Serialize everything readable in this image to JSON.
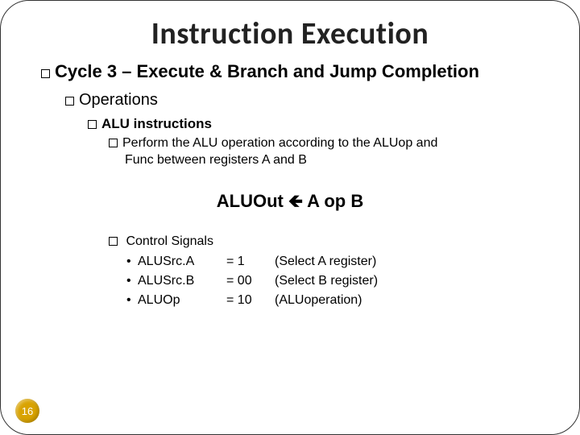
{
  "title": "Instruction Execution",
  "l1_prefix_bold": "Cycle 3",
  "l1_rest": " – Execute & Branch and Jump Completion",
  "l2": "Operations",
  "l3": "ALU instructions",
  "l4_a": "Perform the ALU operation according to the ALUop and",
  "l4_b": "Func between registers A and B",
  "expr_lhs": "ALUOut ",
  "expr_rhs": " A op B",
  "signals_head": " Control Signals",
  "signals": [
    {
      "name": "ALUSrc.A",
      "val": "= 1",
      "desc": "(Select A register)"
    },
    {
      "name": "ALUSrc.B",
      "val": "= 00",
      "desc": "(Select B register)"
    },
    {
      "name": "ALUOp",
      "val": "= 10",
      "desc": "(ALUoperation)"
    }
  ],
  "page": "16"
}
